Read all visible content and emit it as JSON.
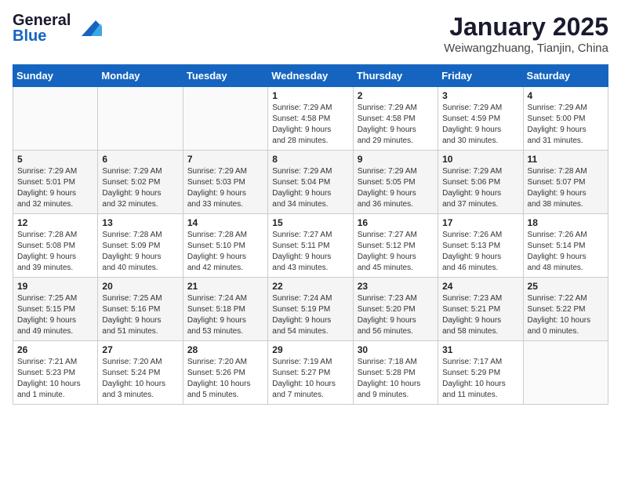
{
  "header": {
    "logo_line1": "General",
    "logo_line2": "Blue",
    "month": "January 2025",
    "location": "Weiwangzhuang, Tianjin, China"
  },
  "weekdays": [
    "Sunday",
    "Monday",
    "Tuesday",
    "Wednesday",
    "Thursday",
    "Friday",
    "Saturday"
  ],
  "weeks": [
    [
      {
        "day": "",
        "info": ""
      },
      {
        "day": "",
        "info": ""
      },
      {
        "day": "",
        "info": ""
      },
      {
        "day": "1",
        "info": "Sunrise: 7:29 AM\nSunset: 4:58 PM\nDaylight: 9 hours\nand 28 minutes."
      },
      {
        "day": "2",
        "info": "Sunrise: 7:29 AM\nSunset: 4:58 PM\nDaylight: 9 hours\nand 29 minutes."
      },
      {
        "day": "3",
        "info": "Sunrise: 7:29 AM\nSunset: 4:59 PM\nDaylight: 9 hours\nand 30 minutes."
      },
      {
        "day": "4",
        "info": "Sunrise: 7:29 AM\nSunset: 5:00 PM\nDaylight: 9 hours\nand 31 minutes."
      }
    ],
    [
      {
        "day": "5",
        "info": "Sunrise: 7:29 AM\nSunset: 5:01 PM\nDaylight: 9 hours\nand 32 minutes."
      },
      {
        "day": "6",
        "info": "Sunrise: 7:29 AM\nSunset: 5:02 PM\nDaylight: 9 hours\nand 32 minutes."
      },
      {
        "day": "7",
        "info": "Sunrise: 7:29 AM\nSunset: 5:03 PM\nDaylight: 9 hours\nand 33 minutes."
      },
      {
        "day": "8",
        "info": "Sunrise: 7:29 AM\nSunset: 5:04 PM\nDaylight: 9 hours\nand 34 minutes."
      },
      {
        "day": "9",
        "info": "Sunrise: 7:29 AM\nSunset: 5:05 PM\nDaylight: 9 hours\nand 36 minutes."
      },
      {
        "day": "10",
        "info": "Sunrise: 7:29 AM\nSunset: 5:06 PM\nDaylight: 9 hours\nand 37 minutes."
      },
      {
        "day": "11",
        "info": "Sunrise: 7:28 AM\nSunset: 5:07 PM\nDaylight: 9 hours\nand 38 minutes."
      }
    ],
    [
      {
        "day": "12",
        "info": "Sunrise: 7:28 AM\nSunset: 5:08 PM\nDaylight: 9 hours\nand 39 minutes."
      },
      {
        "day": "13",
        "info": "Sunrise: 7:28 AM\nSunset: 5:09 PM\nDaylight: 9 hours\nand 40 minutes."
      },
      {
        "day": "14",
        "info": "Sunrise: 7:28 AM\nSunset: 5:10 PM\nDaylight: 9 hours\nand 42 minutes."
      },
      {
        "day": "15",
        "info": "Sunrise: 7:27 AM\nSunset: 5:11 PM\nDaylight: 9 hours\nand 43 minutes."
      },
      {
        "day": "16",
        "info": "Sunrise: 7:27 AM\nSunset: 5:12 PM\nDaylight: 9 hours\nand 45 minutes."
      },
      {
        "day": "17",
        "info": "Sunrise: 7:26 AM\nSunset: 5:13 PM\nDaylight: 9 hours\nand 46 minutes."
      },
      {
        "day": "18",
        "info": "Sunrise: 7:26 AM\nSunset: 5:14 PM\nDaylight: 9 hours\nand 48 minutes."
      }
    ],
    [
      {
        "day": "19",
        "info": "Sunrise: 7:25 AM\nSunset: 5:15 PM\nDaylight: 9 hours\nand 49 minutes."
      },
      {
        "day": "20",
        "info": "Sunrise: 7:25 AM\nSunset: 5:16 PM\nDaylight: 9 hours\nand 51 minutes."
      },
      {
        "day": "21",
        "info": "Sunrise: 7:24 AM\nSunset: 5:18 PM\nDaylight: 9 hours\nand 53 minutes."
      },
      {
        "day": "22",
        "info": "Sunrise: 7:24 AM\nSunset: 5:19 PM\nDaylight: 9 hours\nand 54 minutes."
      },
      {
        "day": "23",
        "info": "Sunrise: 7:23 AM\nSunset: 5:20 PM\nDaylight: 9 hours\nand 56 minutes."
      },
      {
        "day": "24",
        "info": "Sunrise: 7:23 AM\nSunset: 5:21 PM\nDaylight: 9 hours\nand 58 minutes."
      },
      {
        "day": "25",
        "info": "Sunrise: 7:22 AM\nSunset: 5:22 PM\nDaylight: 10 hours\nand 0 minutes."
      }
    ],
    [
      {
        "day": "26",
        "info": "Sunrise: 7:21 AM\nSunset: 5:23 PM\nDaylight: 10 hours\nand 1 minute."
      },
      {
        "day": "27",
        "info": "Sunrise: 7:20 AM\nSunset: 5:24 PM\nDaylight: 10 hours\nand 3 minutes."
      },
      {
        "day": "28",
        "info": "Sunrise: 7:20 AM\nSunset: 5:26 PM\nDaylight: 10 hours\nand 5 minutes."
      },
      {
        "day": "29",
        "info": "Sunrise: 7:19 AM\nSunset: 5:27 PM\nDaylight: 10 hours\nand 7 minutes."
      },
      {
        "day": "30",
        "info": "Sunrise: 7:18 AM\nSunset: 5:28 PM\nDaylight: 10 hours\nand 9 minutes."
      },
      {
        "day": "31",
        "info": "Sunrise: 7:17 AM\nSunset: 5:29 PM\nDaylight: 10 hours\nand 11 minutes."
      },
      {
        "day": "",
        "info": ""
      }
    ]
  ]
}
